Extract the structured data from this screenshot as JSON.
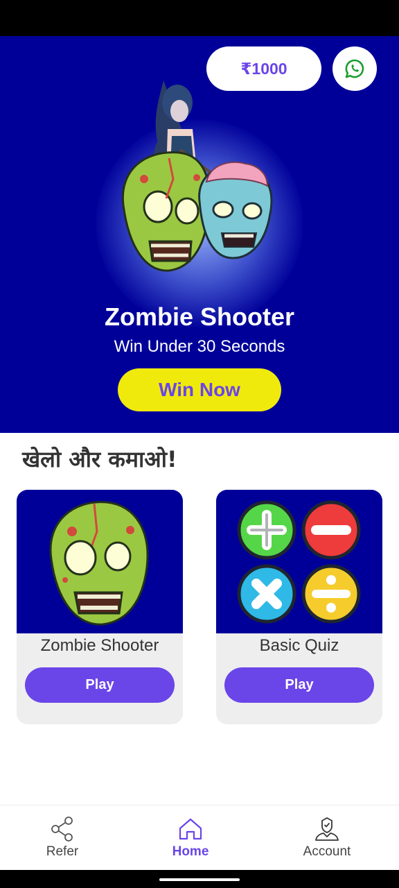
{
  "balance": "₹1000",
  "hero": {
    "title": "Zombie Shooter",
    "subtitle": "Win Under 30 Seconds",
    "cta": "Win Now"
  },
  "section_heading": "खेलो और कमाओ!",
  "games": [
    {
      "title": "Zombie Shooter",
      "play_label": "Play",
      "thumb_icon": "zombie-head-icon"
    },
    {
      "title": "Basic Quiz",
      "play_label": "Play",
      "thumb_icon": "math-operators-icon"
    }
  ],
  "nav": {
    "items": [
      {
        "label": "Refer",
        "icon": "share-icon",
        "active": false
      },
      {
        "label": "Home",
        "icon": "home-icon",
        "active": true
      },
      {
        "label": "Account",
        "icon": "account-icon",
        "active": false
      }
    ]
  },
  "colors": {
    "hero_background": "#000099",
    "accent_purple": "#6a45e8",
    "cta_yellow": "#f0ea0c",
    "card_background": "#eeeeee",
    "whatsapp_green": "#1a9e2c"
  }
}
